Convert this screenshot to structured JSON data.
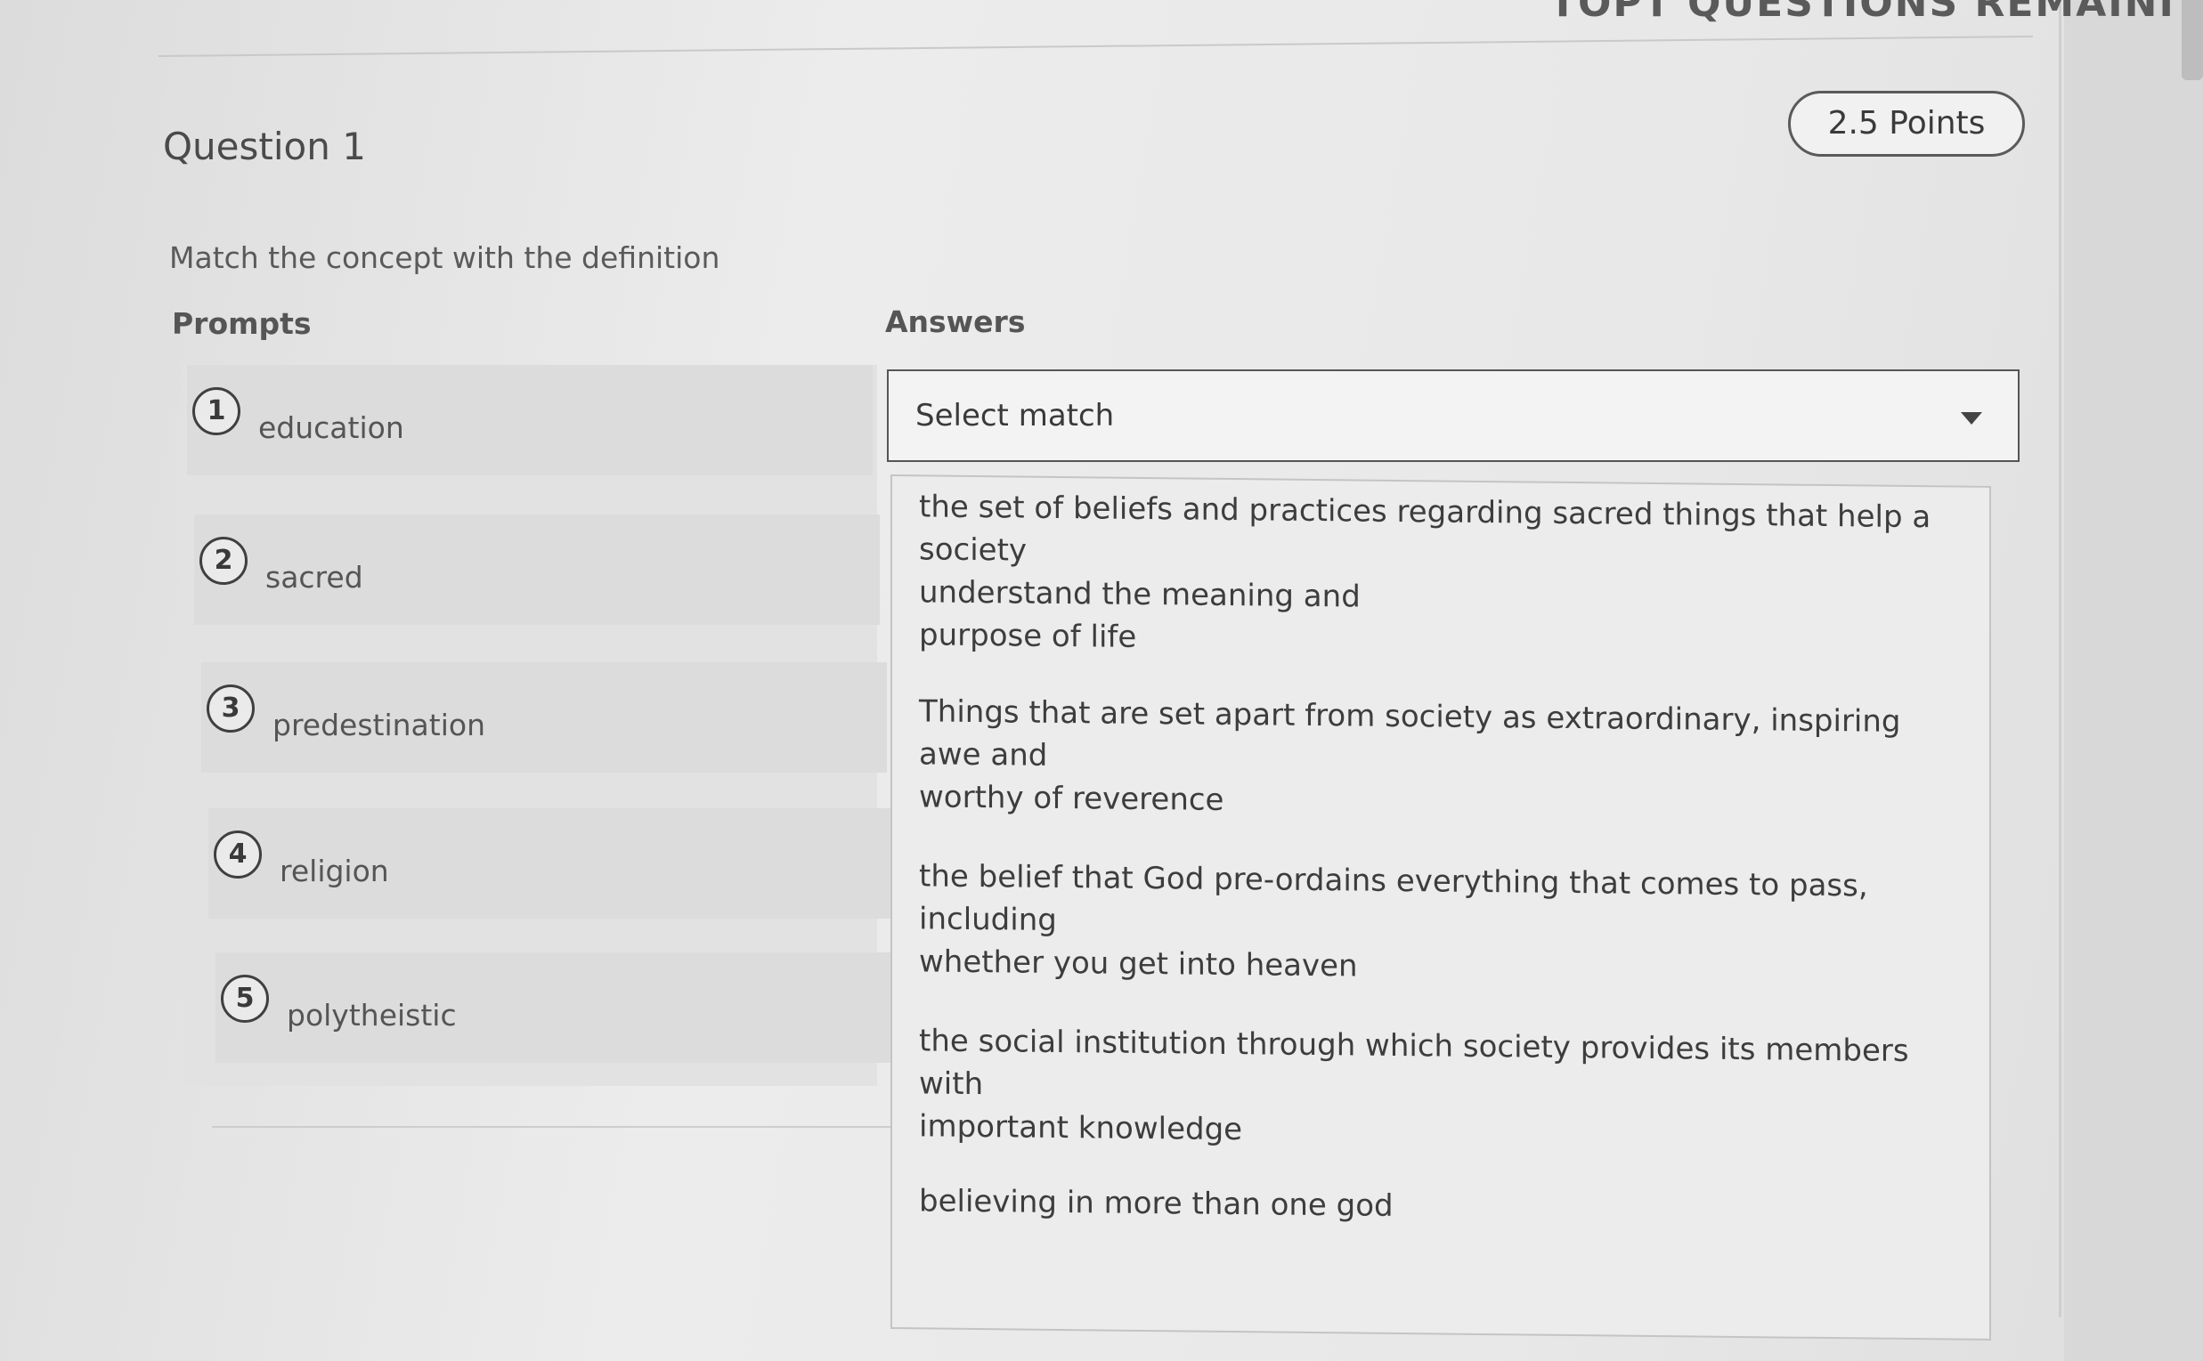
{
  "header": {
    "banner_text": "TOPT QUESTIONS REMAINI"
  },
  "question": {
    "title": "Question 1",
    "points": "2.5 Points",
    "instruction": "Match the concept with the definition"
  },
  "columns": {
    "prompts_label": "Prompts",
    "answers_label": "Answers"
  },
  "prompts": [
    {
      "number": "1",
      "text": "education"
    },
    {
      "number": "2",
      "text": "sacred"
    },
    {
      "number": "3",
      "text": "predestination"
    },
    {
      "number": "4",
      "text": "religion"
    },
    {
      "number": "5",
      "text": "polytheistic"
    }
  ],
  "select": {
    "placeholder": "Select match"
  },
  "options": [
    {
      "line1": "the set of beliefs and practices regarding sacred things that help a society",
      "line2": "understand the meaning and",
      "line3": "purpose of life"
    },
    {
      "line1": "Things that are set apart from society as extraordinary, inspiring awe and",
      "line2": "worthy of reverence",
      "line3": ""
    },
    {
      "line1": "the belief that God pre-ordains everything that comes to pass, including",
      "line2": "whether you get into heaven",
      "line3": ""
    },
    {
      "line1": "the social institution through which society provides its members with",
      "line2": "important knowledge",
      "line3": ""
    },
    {
      "line1": "believing in more than one god",
      "line2": "",
      "line3": ""
    }
  ]
}
